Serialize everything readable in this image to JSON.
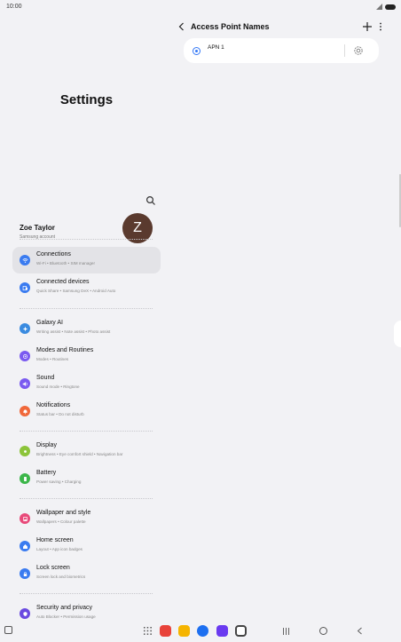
{
  "status_bar": {
    "time": "10:00"
  },
  "left_pane": {
    "title": "Settings",
    "profile": {
      "name": "Zoe Taylor",
      "subtitle": "Samsung account",
      "initial": "Z"
    },
    "items": [
      {
        "title": "Connections",
        "subtitle": "Wi-Fi  •  Bluetooth  •  SIM manager",
        "icon": "wifi-icon",
        "color": "#3a7bf0",
        "selected": true
      },
      {
        "title": "Connected devices",
        "subtitle": "Quick Share  •  Samsung DeX  •  Android Auto",
        "icon": "devices-icon",
        "color": "#3a7bf0"
      },
      {
        "title": "Galaxy AI",
        "subtitle": "Writing assist  •  Note assist  •  Photo assist",
        "icon": "ai-icon",
        "color": "#3a8be0"
      },
      {
        "title": "Modes and Routines",
        "subtitle": "Modes  •  Routines",
        "icon": "modes-icon",
        "color": "#7a5af0"
      },
      {
        "title": "Sound",
        "subtitle": "Sound mode  •  Ringtone",
        "icon": "sound-icon",
        "color": "#7a5af0"
      },
      {
        "title": "Notifications",
        "subtitle": "Status bar  •  Do not disturb",
        "icon": "bell-icon",
        "color": "#f0683a"
      },
      {
        "title": "Display",
        "subtitle": "Brightness  •  Eye comfort shield  •  Navigation bar",
        "icon": "sun-icon",
        "color": "#8cc43a"
      },
      {
        "title": "Battery",
        "subtitle": "Power saving  •  Charging",
        "icon": "battery-icon",
        "color": "#3cb64a"
      },
      {
        "title": "Wallpaper and style",
        "subtitle": "Wallpapers  •  Colour palette",
        "icon": "wallpaper-icon",
        "color": "#e84a7a"
      },
      {
        "title": "Home screen",
        "subtitle": "Layout  •  App icon badges",
        "icon": "home-icon",
        "color": "#3a7bf0"
      },
      {
        "title": "Lock screen",
        "subtitle": "Screen lock and biometrics",
        "icon": "lock-icon",
        "color": "#3a7bf0"
      },
      {
        "title": "Security and privacy",
        "subtitle": "Auto Blocker  •  Permission usage",
        "icon": "shield-icon",
        "color": "#6a4ae0"
      }
    ]
  },
  "right_pane": {
    "title": "Access Point Names",
    "apn": {
      "name": "APN 1",
      "selected": true
    }
  },
  "dock": {
    "apps": [
      {
        "name": "app-red-icon",
        "color": "#e8423a"
      },
      {
        "name": "app-yellow-icon",
        "color": "#f5b400"
      },
      {
        "name": "app-messages-icon",
        "color": "#1d6ff0"
      },
      {
        "name": "app-purple-icon",
        "color": "#6a3af0"
      },
      {
        "name": "app-camera-icon",
        "color": "#444444"
      }
    ]
  }
}
